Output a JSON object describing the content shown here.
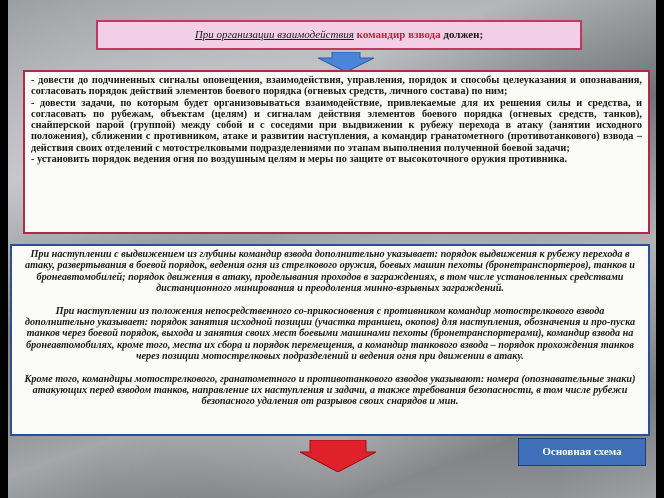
{
  "header": {
    "part1": "При организации взаимодействия",
    "part2": "командир взвода",
    "part3": "должен;"
  },
  "main": {
    "paragraphs": [
      "- довести до подчиненных сигналы оповещения, взаимодействия, управления, порядок и способы целеуказания и опознавания, согласовать порядок действий элементов боевого порядка (огневых средств, личного состава) по ним;",
      "- довести задачи, по которым будет организовываться взаимодействие, привлекаемые для их решения силы и средства, и согласовать по рубежам, объектам (целям) и сигналам действия элементов боевого порядка (огневых средств, танков), снайперской парой (группой) между собой и с соседями при выдвижении к рубежу перехода в атаку (занятии исходного положения), сближении с противником, атаке и развитии наступления, а командир гранатометного (противотанкового) взвода – действия своих отделений с мотострелковыми подразделениями по этапам выполнения полученной боевой задачи;",
      "- установить порядок ведения огня по воздушным целям и меры по защите от высокоточного оружия противника."
    ]
  },
  "lower": {
    "block1": "При наступлении с выдвижением из глубины командир взвода дополнительно указывает: порядок выдвижения к рубежу перехода в атаку, развертывания в боевой порядок, ведения огня из стрелкового оружия, боевых машин пехоты (бронетранспортеров), танков и бронеавтомобилей; порядок движения в атаку, проделывания проходов в заграждениях, в том числе установленных средствами дистанционного минирования и преодоления минно-взрывных заграждений.",
    "block2": "При наступлении из положения непосредственного со-прикосновения с противником командир мотострелкового взвода дополнительно указывает: порядок занятия исходной позиции (участка траншеи, окопов) для наступления, обозначения и про-пуска танков через боевой порядок, выхода и занятия своих мест боевыми машинами пехоты (бронетранспортерами), командир взвода на бронеавтомобилях, кроме того, места их сбора и порядок перемещения, а командир танкового взвода – порядок прохождения танков через позиции мотострелковых подразделений и ведения огня при движении в атаку.",
    "block3": "Кроме того, командиры мотострелкового, гранатометного и противотанкового взводов указывают: номера (опознавательные знаки) атакующих перед взводом танков, направление их наступления и задачи, а также требования безопасности, в том числе рубежи безопасного удаления от разрывов своих снарядов и мин."
  },
  "button": {
    "label": "Основная схема"
  },
  "colors": {
    "header_bg": "#f2cfe6",
    "header_border": "#c0395e",
    "main_border": "#b0284a",
    "lower_border": "#2b4f9c",
    "button_bg": "#3e6fb8",
    "arrow_blue": "#4a86d8",
    "arrow_red": "#e0202a"
  },
  "icons": {
    "top_arrow": "down-arrow-icon",
    "bottom_arrow": "down-arrow-icon"
  }
}
